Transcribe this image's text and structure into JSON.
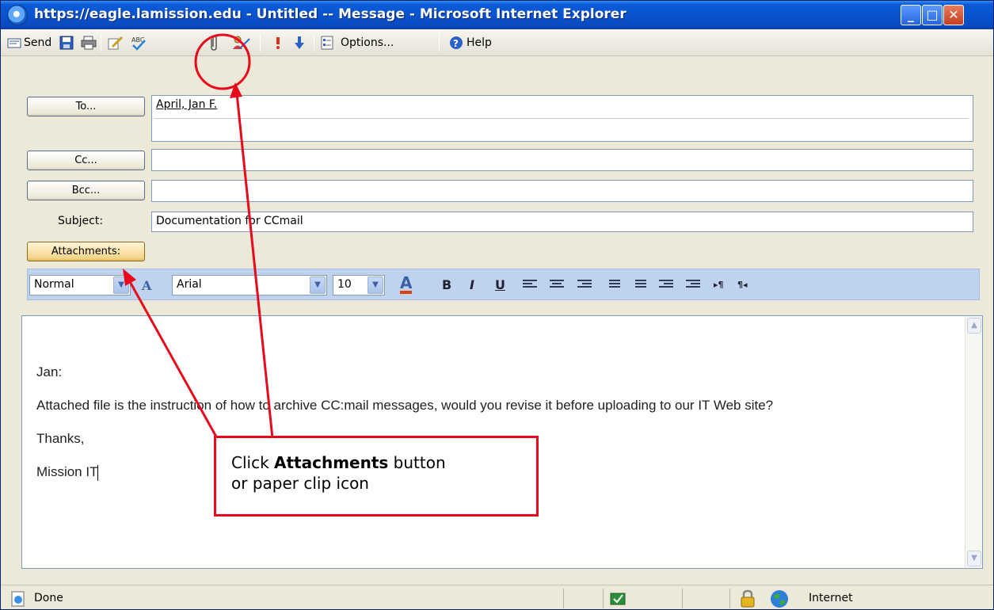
{
  "window": {
    "title": "https://eagle.lamission.edu - Untitled -- Message - Microsoft Internet Explorer",
    "controls": {
      "minimize": "_",
      "maximize": "□",
      "close": "✕"
    }
  },
  "toolbar": {
    "send_label": "Send",
    "options_label": "Options...",
    "help_label": "Help",
    "icons": [
      "send-icon",
      "save-icon",
      "print-icon",
      "edit-icon",
      "spellcheck-icon",
      "paperclip-icon",
      "address-book-icon",
      "high-importance-icon",
      "low-importance-icon",
      "options-icon",
      "help-icon"
    ]
  },
  "form": {
    "to_button": "To...",
    "to_value": "April, Jan F.",
    "cc_button": "Cc...",
    "cc_value": "",
    "bcc_button": "Bcc...",
    "bcc_value": "",
    "subject_label": "Subject:",
    "subject_value": "Documentation for CCmail",
    "attachments_button": "Attachments:"
  },
  "format_bar": {
    "style_value": "Normal",
    "font_value": "Arial",
    "size_value": "10"
  },
  "message": {
    "greeting": "Jan:",
    "body": "Attached file is the instruction of how to archive CC:mail messages, would you revise it before uploading to our IT Web site?",
    "closing": "Thanks,",
    "signature": "Mission IT"
  },
  "status_bar": {
    "status": "Done",
    "zone": "Internet"
  },
  "annotation": {
    "callout_prefix": "Click ",
    "callout_bold": "Attachments",
    "callout_suffix": " button",
    "callout_line2": "or paper clip icon",
    "color": "#e8091c"
  },
  "colors": {
    "titlebar": "#0854d0",
    "format_bar": "#bfd3ee",
    "annotation": "#e8091c"
  }
}
